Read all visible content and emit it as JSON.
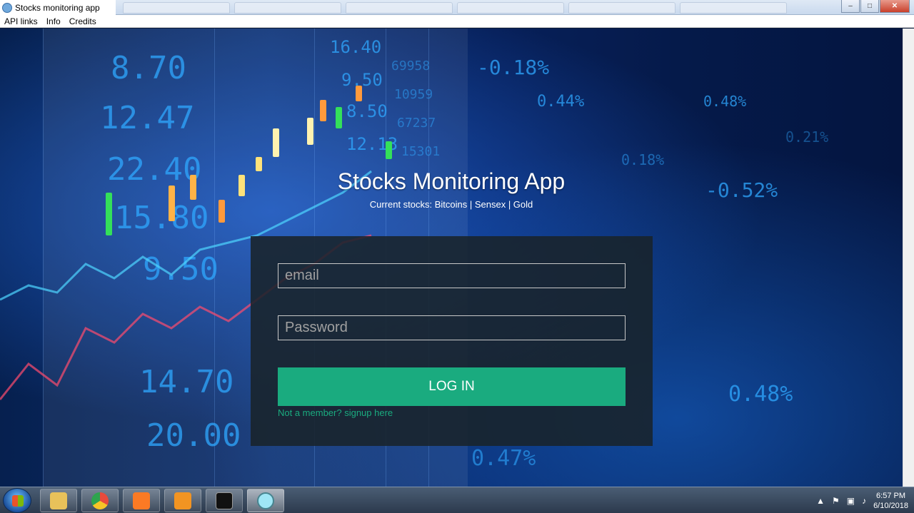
{
  "window": {
    "title": "Stocks monitoring app",
    "controls": {
      "minimize": "–",
      "maximize": "□",
      "close": "✕"
    }
  },
  "menu": {
    "items": [
      "API links",
      "Info",
      "Credits"
    ]
  },
  "main": {
    "heading": "Stocks Monitoring App",
    "subheading": "Current stocks: Bitcoins | Sensex | Gold",
    "login": {
      "email_placeholder": "email",
      "password_placeholder": "Password",
      "button_label": "LOG IN",
      "signup_text": "Not a member? signup here"
    }
  },
  "background_numbers": [
    "8.70",
    "12.47",
    "22.40",
    "15.80",
    "9.50",
    "14.70",
    "20.00",
    "-0.18%",
    "0.44%",
    "0.48%",
    "0.18%",
    "-0.52%",
    "0.21%",
    "0.48%",
    "0.47%",
    "16.40",
    "9.50",
    "8.50",
    "12.13",
    "69958",
    "10959",
    "67237",
    "15301"
  ],
  "colors": {
    "accent": "#1aab7f",
    "panel": "#19232a",
    "background": "#0b2e6e"
  },
  "taskbar": {
    "apps": [
      {
        "name": "file-explorer-icon",
        "color": "#e8c15a"
      },
      {
        "name": "chrome-icon",
        "color": "#e84a3c"
      },
      {
        "name": "xampp-icon",
        "color": "#fb7a24"
      },
      {
        "name": "sublime-icon",
        "color": "#f29422"
      },
      {
        "name": "cmd-icon",
        "color": "#111111"
      },
      {
        "name": "electron-icon",
        "color": "#9fe6f5"
      }
    ],
    "clock_time": "6:57 PM",
    "clock_date": "6/10/2018"
  }
}
